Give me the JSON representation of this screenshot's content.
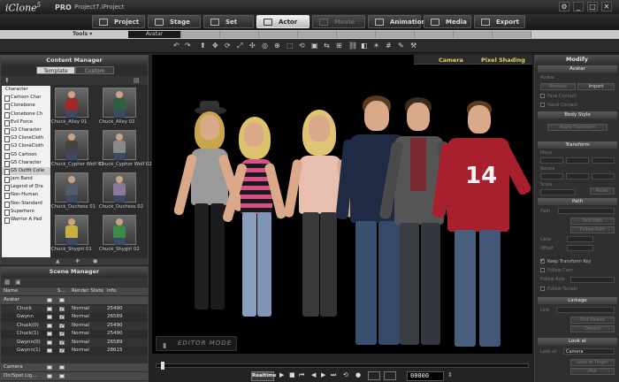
{
  "app": {
    "logo": "iClone",
    "version": "5",
    "edition": "PRO",
    "project": "Project7.iProject",
    "window_buttons": [
      "⚙",
      "_",
      "□",
      "✕"
    ]
  },
  "main_tabs": [
    {
      "label": "Project",
      "state": "normal"
    },
    {
      "label": "Stage",
      "state": "normal"
    },
    {
      "label": "Set",
      "state": "normal"
    },
    {
      "label": "Actor",
      "state": "active"
    },
    {
      "label": "Movie",
      "state": "dim"
    },
    {
      "label": "Animation",
      "state": "normal"
    },
    {
      "label": "Media",
      "state": "normal"
    },
    {
      "label": "Export",
      "state": "normal"
    }
  ],
  "tools": {
    "label": "Tools ▾",
    "subtabs": [
      "Avatar"
    ]
  },
  "content_manager": {
    "title": "Content Manager",
    "tabs": [
      "Template",
      "Custom"
    ],
    "tree": [
      {
        "label": "Character",
        "root": true
      },
      {
        "label": "Cartoon Char",
        "root": false
      },
      {
        "label": "Clonebone",
        "root": false
      },
      {
        "label": "Clonebone Ch",
        "root": false
      },
      {
        "label": "Evil Force",
        "root": false
      },
      {
        "label": "G3 Character",
        "root": false
      },
      {
        "label": "G3 CloneCloth",
        "root": false
      },
      {
        "label": "G3 CloneCloth",
        "root": false
      },
      {
        "label": "G5 Cartoon",
        "root": false
      },
      {
        "label": "G5 Character",
        "root": false
      },
      {
        "label": "G5 Outfit Colle",
        "root": false,
        "selected": true
      },
      {
        "label": "Jam Band",
        "root": false
      },
      {
        "label": "Legend of Dra",
        "root": false
      },
      {
        "label": "Non-Human",
        "root": false
      },
      {
        "label": "Non-Standard",
        "root": false
      },
      {
        "label": "Superhero",
        "root": false
      },
      {
        "label": "Warrior A Pad",
        "root": false
      }
    ],
    "thumbnails": [
      {
        "label": "Chuck_Alley 01",
        "color": "#a02828"
      },
      {
        "label": "Chuck_Alley 02",
        "color": "#2d6040"
      },
      {
        "label": "Chuck_Cypher Wolf 01",
        "color": "#444444"
      },
      {
        "label": "Chuck_Cypher Wolf 02",
        "color": "#8a8a8a"
      },
      {
        "label": "Chuck_Duchess 01",
        "color": "#555a66"
      },
      {
        "label": "Chuck_Duchess 02",
        "color": "#8a7a9a"
      },
      {
        "label": "Chuck_Shygirl 01",
        "color": "#c8b040"
      },
      {
        "label": "Chuck_Shygirl 02",
        "color": "#3a8a4a"
      }
    ]
  },
  "scene_manager": {
    "title": "Scene Manager",
    "columns": [
      "Name",
      "S...",
      "Render State",
      "Info"
    ],
    "rows": [
      {
        "name": "Avatar",
        "checked": false,
        "render": "",
        "info": "",
        "group": true
      },
      {
        "name": "Chuck",
        "checked": true,
        "render": "Normal",
        "info": "25490",
        "group": false
      },
      {
        "name": "Gwynn",
        "checked": true,
        "render": "Normal",
        "info": "26589",
        "group": false
      },
      {
        "name": "Chuck(0)",
        "checked": true,
        "render": "Normal",
        "info": "25490",
        "group": false
      },
      {
        "name": "Chuck(1)",
        "checked": true,
        "render": "Normal",
        "info": "25490",
        "group": false
      },
      {
        "name": "Gwynn(0)",
        "checked": true,
        "render": "Normal",
        "info": "26589",
        "group": false
      },
      {
        "name": "Gwynn(1)",
        "checked": true,
        "render": "Normal",
        "info": "28615",
        "group": false
      },
      {
        "name": "",
        "checked": false,
        "render": "",
        "info": "",
        "group": false
      },
      {
        "name": "Camera",
        "checked": false,
        "render": "",
        "info": "",
        "group": true
      },
      {
        "name": "Dir/Spot Lig...",
        "checked": false,
        "render": "",
        "info": "",
        "group": true
      }
    ]
  },
  "viewport": {
    "camera_label": "Camera",
    "shading_label": "Pixel Shading",
    "mode_label": "EDITOR MODE",
    "jersey_number": "14"
  },
  "timeline": {
    "realtime_label": "Realtime",
    "frame": "00000",
    "play_icons": [
      "▶",
      "■",
      "⏮",
      "◀",
      "▶",
      "⏭",
      "⟲",
      "●"
    ]
  },
  "modify": {
    "title": "Modify",
    "sections": [
      "Avatar",
      "Body Style",
      "Transform",
      "Path",
      "Linkage",
      "Look at"
    ],
    "import_label": "Import",
    "remove_label": "Remove",
    "face_contact": "Face Contact",
    "hand_contact": "Hand Contact",
    "apply_label": "Apply Transform",
    "move_label": "Move",
    "rotate_label": "Rotate",
    "scale_label": "Scale",
    "reset_label": "Reset",
    "path_label": "Path",
    "pick_path": "Pick Path",
    "follow_path": "Follow Path",
    "lane_label": "Lane",
    "offset_label": "Offset",
    "keep_dist": "Keep Transform Key",
    "follow_cam": "Follow Cam",
    "follow_axis": "Follow Axis",
    "follow_terrain": "Follow Terrain",
    "link_label": "Link",
    "pick_parent": "Pick Parent",
    "detach": "Detach",
    "lookat_label": "Look at",
    "lookat_value": "Camera",
    "look_at_target": "Look at Target",
    "pick_target": "Pick"
  }
}
